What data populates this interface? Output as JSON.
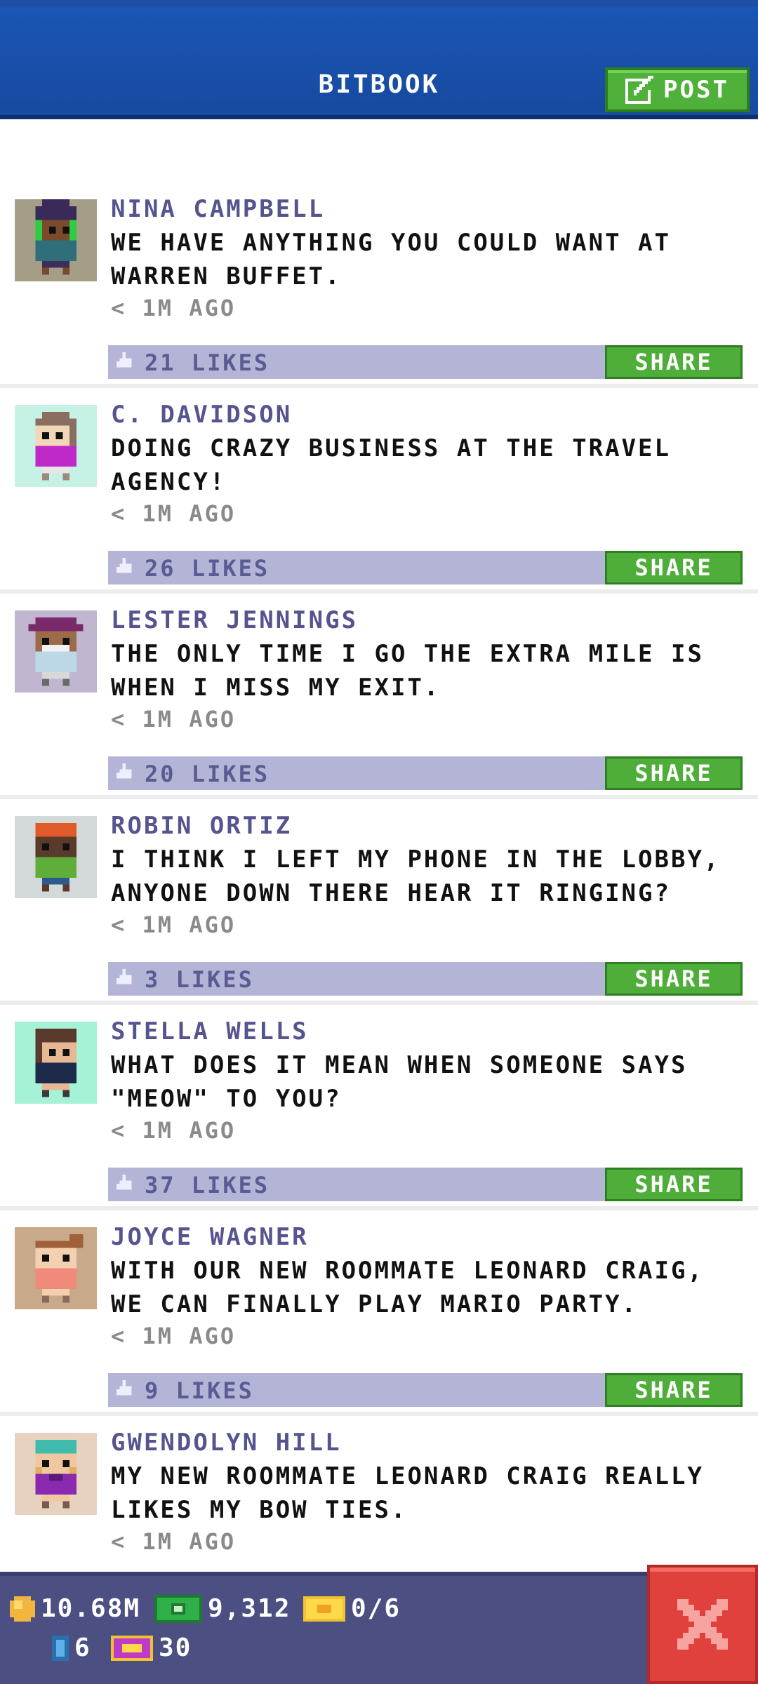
{
  "header": {
    "title": "BITBOOK",
    "post_label": "POST"
  },
  "posts": [
    {
      "name": "NINA CAMPBELL",
      "message": "WE HAVE ANYTHING YOU COULD WANT AT WARREN BUFFET.",
      "time": "< 1M AGO",
      "likes": "21 LIKES",
      "share": "SHARE"
    },
    {
      "name": "C. DAVIDSON",
      "message": "DOING CRAZY BUSINESS AT THE TRAVEL AGENCY!",
      "time": "< 1M AGO",
      "likes": "26 LIKES",
      "share": "SHARE"
    },
    {
      "name": "LESTER JENNINGS",
      "message": "THE ONLY TIME I GO THE EXTRA MILE IS WHEN I MISS MY EXIT.",
      "time": "< 1M AGO",
      "likes": "20 LIKES",
      "share": "SHARE"
    },
    {
      "name": "ROBIN ORTIZ",
      "message": "I THINK I LEFT MY PHONE IN THE LOBBY, ANYONE DOWN THERE HEAR IT RINGING?",
      "time": "< 1M AGO",
      "likes": "3 LIKES",
      "share": "SHARE"
    },
    {
      "name": "STELLA WELLS",
      "message": "WHAT DOES IT MEAN WHEN SOMEONE SAYS \"MEOW\" TO YOU?",
      "time": "< 1M AGO",
      "likes": "37 LIKES",
      "share": "SHARE"
    },
    {
      "name": "JOYCE WAGNER",
      "message": "WITH OUR NEW ROOMMATE LEONARD CRAIG, WE CAN FINALLY PLAY MARIO PARTY.",
      "time": "< 1M AGO",
      "likes": "9 LIKES",
      "share": "SHARE"
    },
    {
      "name": "GWENDOLYN HILL",
      "message": "MY NEW ROOMMATE LEONARD CRAIG REALLY LIKES MY BOW TIES.",
      "time": "< 1M AGO"
    }
  ],
  "footer": {
    "coins": "10.68M",
    "bux": "9,312",
    "tickets": "0/6",
    "keys": "6",
    "vip": "30"
  },
  "colors": {
    "header_blue": "#1a56b5",
    "name_purple": "#55548f",
    "like_bar": "#b4b4d6",
    "share_green": "#4fae3a",
    "footer_bg": "#4b4f82",
    "close_red": "#e0413c"
  }
}
